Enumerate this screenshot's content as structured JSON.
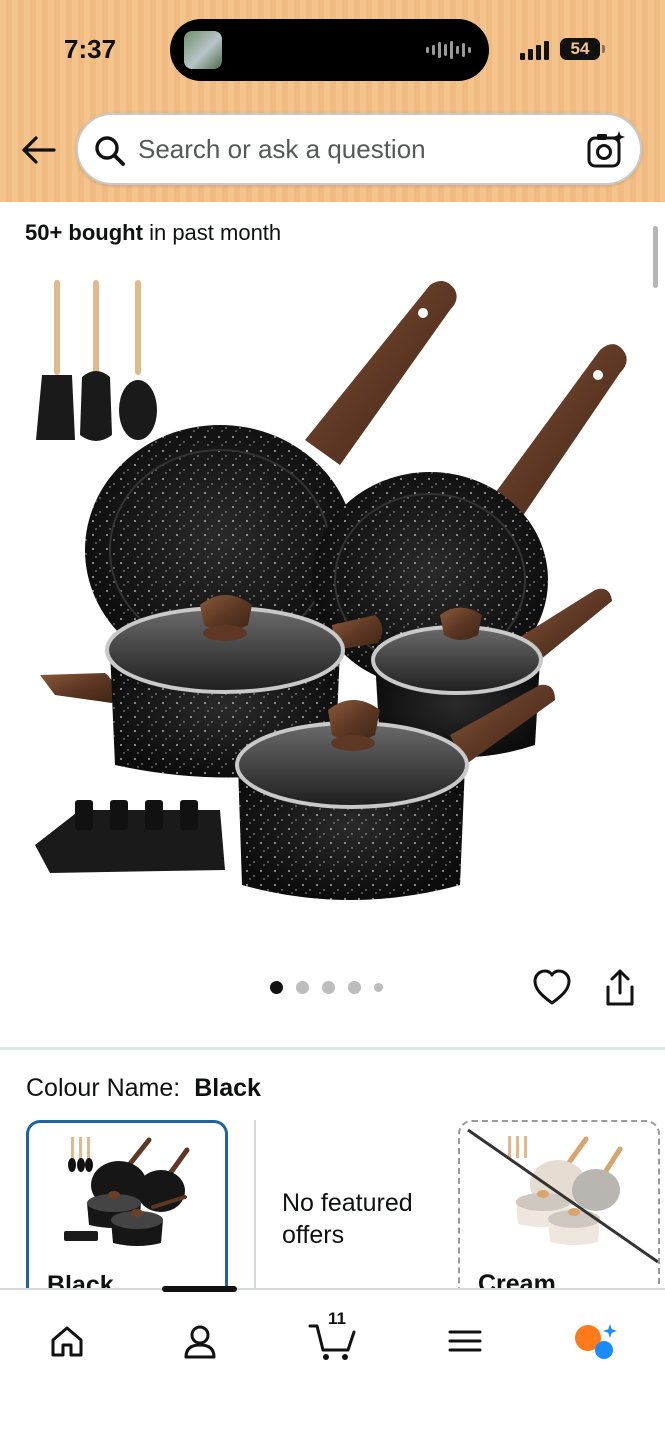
{
  "status_bar": {
    "time": "7:37",
    "battery": "54"
  },
  "search": {
    "placeholder": "Search or ask a question"
  },
  "social_proof": {
    "bold": "50+ bought",
    "rest": "in past month"
  },
  "product": {
    "image_alt": "11-piece black granite non-stick cookware set with wood-grain handles",
    "carousel": {
      "count": 5,
      "active_index": 0
    }
  },
  "variation": {
    "label": "Colour Name:",
    "selected": "Black",
    "swatches": [
      {
        "label": "Black",
        "selected": true,
        "available": true
      },
      {
        "label": "No featured offers",
        "placeholder": true
      },
      {
        "label": "Cream",
        "selected": false,
        "available": false
      }
    ]
  },
  "bottom_nav": {
    "items": [
      "home-icon",
      "account-icon",
      "cart-icon",
      "menu-icon",
      "rufus-icon"
    ],
    "cart_count": "11"
  },
  "colors": {
    "header_bg": "#f5c48c",
    "accent_blue": "#2162a1",
    "rufus_orange": "#ff7a1a",
    "rufus_blue": "#1a8cff"
  }
}
